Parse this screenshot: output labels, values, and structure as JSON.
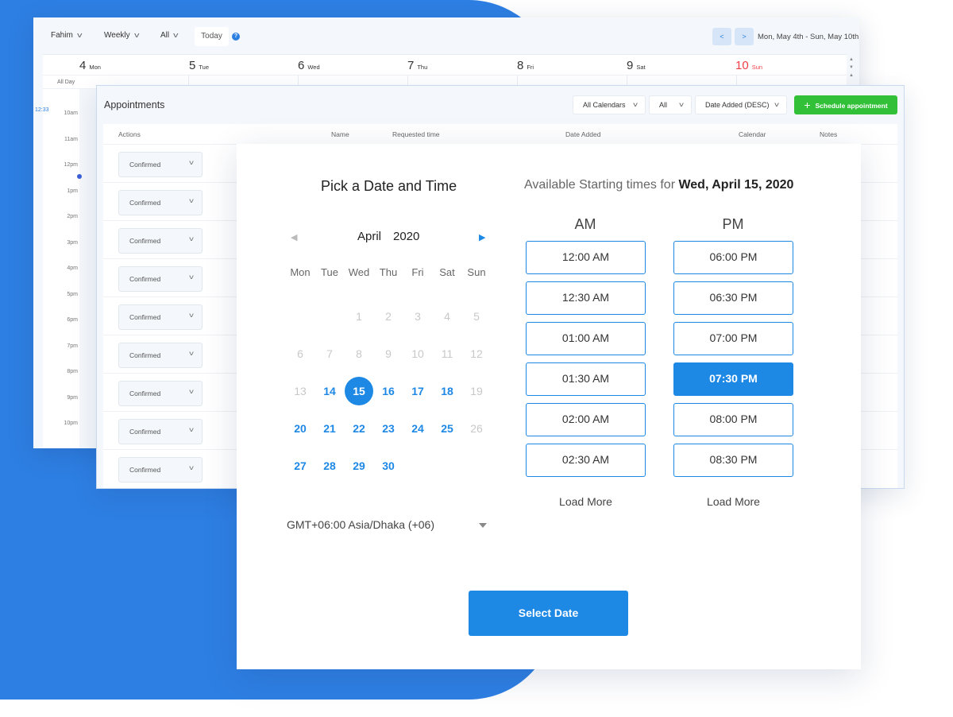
{
  "colors": {
    "accent": "#1e88e5",
    "primary_bg_shape": "#2e7fe3",
    "success": "#32c038",
    "sunday": "#ef3e45"
  },
  "calendar_window": {
    "toolbar": {
      "user_dropdown": "Fahim",
      "view_dropdown": "Weekly",
      "filter_dropdown": "All",
      "today_button": "Today",
      "prev_button": "<",
      "next_button": ">",
      "date_range": "Mon, May 4th - Sun, May 10th"
    },
    "days": [
      {
        "num": "4",
        "name": "Mon"
      },
      {
        "num": "5",
        "name": "Tue"
      },
      {
        "num": "6",
        "name": "Wed"
      },
      {
        "num": "7",
        "name": "Thu"
      },
      {
        "num": "8",
        "name": "Fri"
      },
      {
        "num": "9",
        "name": "Sat"
      },
      {
        "num": "10",
        "name": "Sun"
      }
    ],
    "all_day_label": "All Day",
    "now_time": "12:33",
    "time_labels": [
      "10am",
      "11am",
      "12pm",
      "1pm",
      "2pm",
      "3pm",
      "4pm",
      "5pm",
      "6pm",
      "7pm",
      "8pm",
      "9pm",
      "10pm"
    ]
  },
  "appointments_window": {
    "title": "Appointments",
    "filters": {
      "calendars": "All Calendars",
      "status": "All",
      "sort": "Date Added (DESC)"
    },
    "schedule_button": "Schedule appointment",
    "columns": [
      "Actions",
      "Name",
      "Requested time",
      "Date Added",
      "Calendar",
      "Notes"
    ],
    "rows": [
      "Confirmed",
      "Confirmed",
      "Confirmed",
      "Confirmed",
      "Confirmed",
      "Confirmed",
      "Confirmed",
      "Confirmed",
      "Confirmed"
    ]
  },
  "picker": {
    "title": "Pick a Date and Time",
    "available_prefix": "Available Starting times for",
    "selected_date": "Wed, April 15, 2020",
    "month": "April",
    "year": "2020",
    "weekdays": [
      "Mon",
      "Tue",
      "Wed",
      "Thu",
      "Fri",
      "Sat",
      "Sun"
    ],
    "weeks": [
      [
        "",
        "",
        "1",
        "2",
        "3",
        "4",
        "5"
      ],
      [
        "6",
        "7",
        "8",
        "9",
        "10",
        "11",
        "12"
      ],
      [
        "13",
        "14",
        "15",
        "16",
        "17",
        "18",
        "19"
      ],
      [
        "20",
        "21",
        "22",
        "23",
        "24",
        "25",
        "26"
      ],
      [
        "27",
        "28",
        "29",
        "30",
        "",
        "",
        ""
      ]
    ],
    "available_days": [
      "14",
      "15",
      "16",
      "17",
      "18",
      "20",
      "21",
      "22",
      "23",
      "24",
      "25",
      "27",
      "28",
      "29",
      "30"
    ],
    "selected_day": "15",
    "timezone": "GMT+06:00 Asia/Dhaka (+06)",
    "am_label": "AM",
    "pm_label": "PM",
    "am_slots": [
      "12:00 AM",
      "12:30 AM",
      "01:00 AM",
      "01:30 AM",
      "02:00 AM",
      "02:30 AM"
    ],
    "pm_slots": [
      "06:00 PM",
      "06:30 PM",
      "07:00 PM",
      "07:30 PM",
      "08:00 PM",
      "08:30 PM"
    ],
    "selected_slot": "07:30 PM",
    "load_more": "Load More",
    "select_button": "Select Date"
  }
}
